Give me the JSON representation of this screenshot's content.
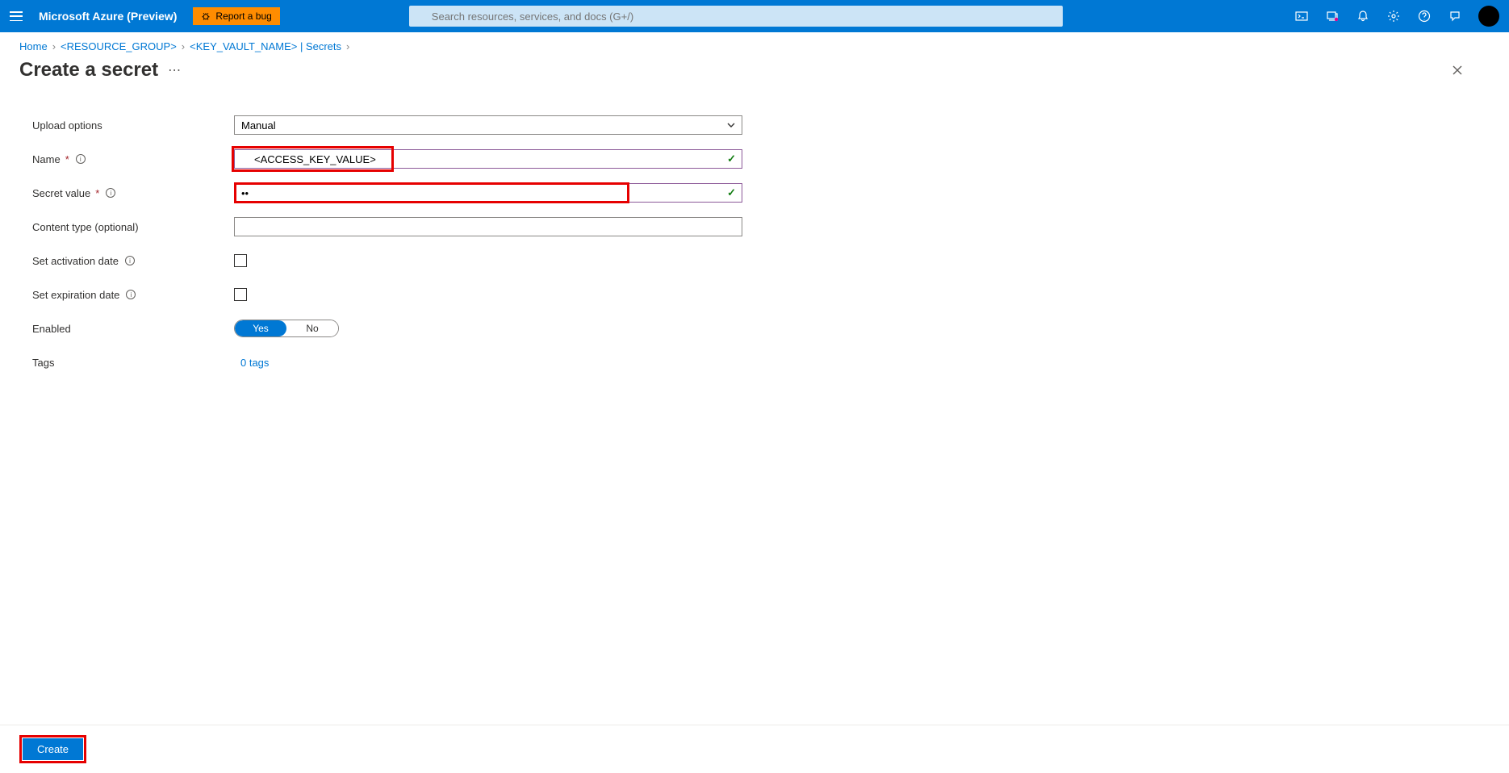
{
  "header": {
    "brand": "Microsoft Azure (Preview)",
    "report_bug": "Report a bug",
    "search_placeholder": "Search resources, services, and docs (G+/)"
  },
  "breadcrumb": {
    "home": "Home",
    "resource_group": "<RESOURCE_GROUP>",
    "keyvault_secrets": "<KEY_VAULT_NAME> | Secrets"
  },
  "title": "Create a secret",
  "form": {
    "upload_options_label": "Upload options",
    "upload_options_value": "Manual",
    "name_label": "Name",
    "name_value": "<ACCESS_KEY_VALUE>",
    "secret_value_label": "Secret value",
    "secret_value_value": "••",
    "content_type_label": "Content type (optional)",
    "content_type_value": "",
    "activation_label": "Set activation date",
    "expiration_label": "Set expiration date",
    "enabled_label": "Enabled",
    "enabled_yes": "Yes",
    "enabled_no": "No",
    "tags_label": "Tags",
    "tags_link": "0 tags"
  },
  "footer": {
    "create": "Create"
  }
}
